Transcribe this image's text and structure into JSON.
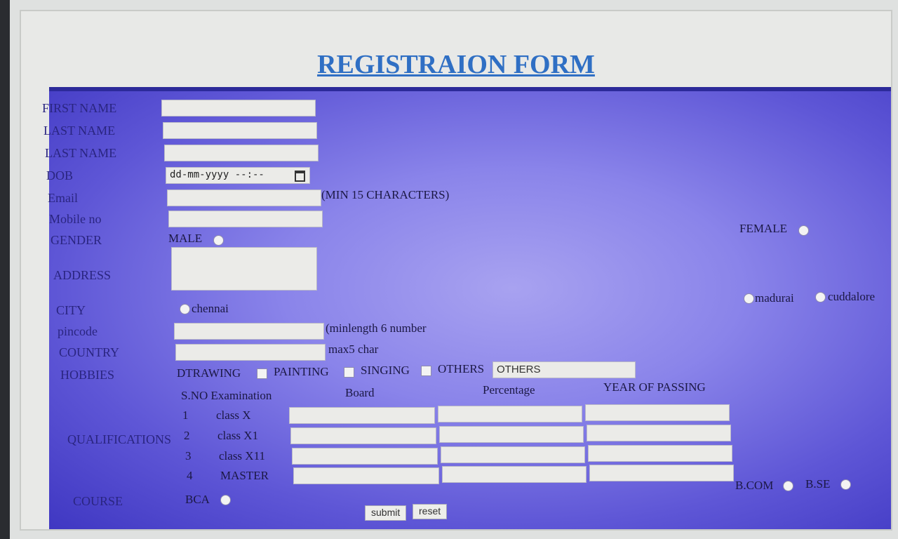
{
  "title": "REGISTRAION FORM",
  "fields": {
    "first_name": "FIRST NAME",
    "last_name_1": "LAST NAME",
    "last_name_2": "LAST NAME",
    "dob": "DOB",
    "dob_placeholder": "dd-mm-yyyy --:--",
    "email": "Email",
    "email_note": "(MIN 15 CHARACTERS)",
    "mobile": "Mobile no",
    "gender": "GENDER",
    "address": "ADDRESS",
    "city": "CITY",
    "pincode": "pincode",
    "pincode_note": "(minlength 6 number",
    "country": "COUNTRY",
    "country_note": "max5 char",
    "hobbies": "HOBBIES",
    "qualifications": "QUALIFICATIONS",
    "course": "COURSE"
  },
  "gender_options": [
    "MALE",
    "FEMALE"
  ],
  "city_options": [
    "chennai",
    "madurai",
    "cuddalore"
  ],
  "hobby_options": [
    "DTRAWING",
    "PAINTING",
    "SINGING",
    "OTHERS"
  ],
  "others_value": "OTHERS",
  "qual_headers": [
    "S.NO Examination",
    "Board",
    "Percentage",
    "YEAR OF PASSING"
  ],
  "qual_rows": [
    {
      "sno": "1",
      "exam": "class X"
    },
    {
      "sno": "2",
      "exam": "class X1"
    },
    {
      "sno": "3",
      "exam": "class X11"
    },
    {
      "sno": "4",
      "exam": "MASTER"
    }
  ],
  "course_options": [
    "BCA",
    "B.COM",
    "B.SE"
  ],
  "buttons": {
    "submit": "submit",
    "reset": "reset"
  }
}
